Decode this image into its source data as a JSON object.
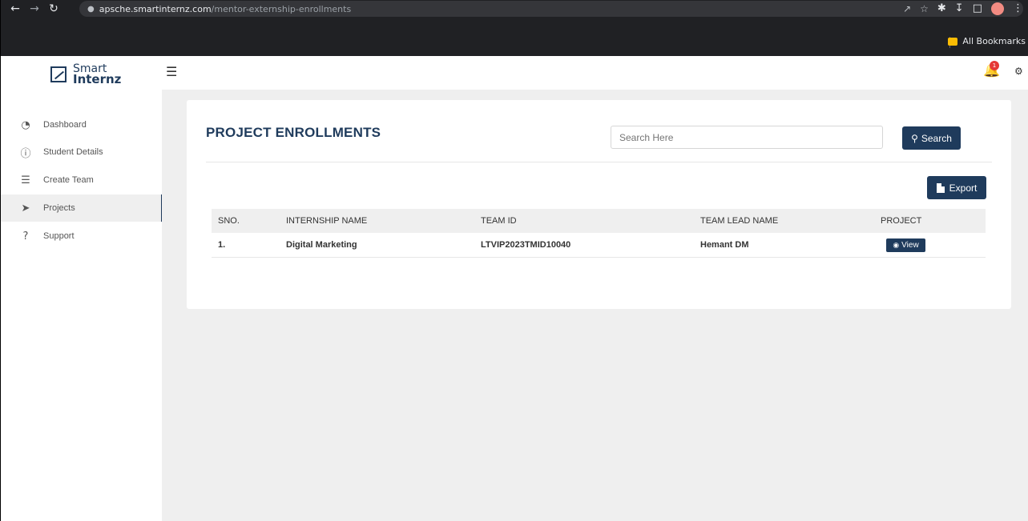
{
  "browser": {
    "url_host": "apsche.smartinternz.com",
    "url_path": "/mentor-externship-enrollments",
    "bookmarks_label": "All Bookmarks"
  },
  "header": {
    "logo_line1": "Smart",
    "logo_line2": "Internz",
    "notification_count": "1"
  },
  "sidebar": {
    "items": [
      {
        "label": "Dashboard",
        "icon": "gauge-icon"
      },
      {
        "label": "Student Details",
        "icon": "info-icon"
      },
      {
        "label": "Create Team",
        "icon": "list-icon"
      },
      {
        "label": "Projects",
        "icon": "paper-plane-icon",
        "active": true
      },
      {
        "label": "Support",
        "icon": "question-icon"
      }
    ]
  },
  "main": {
    "title": "PROJECT ENROLLMENTS",
    "search_placeholder": "Search Here",
    "search_label": "Search",
    "export_label": "Export",
    "table": {
      "headers": [
        "SNO.",
        "INTERNSHIP NAME",
        "TEAM ID",
        "TEAM LEAD NAME",
        "PROJECT"
      ],
      "rows": [
        {
          "sno": "1.",
          "internship_name": "Digital Marketing",
          "team_id": "LTVIP2023TMID10040",
          "team_lead": "Hemant DM",
          "action_label": "View"
        }
      ]
    }
  },
  "colors": {
    "brand": "#1f3b5c",
    "content_bg": "#efefef",
    "badge": "#e53935"
  }
}
